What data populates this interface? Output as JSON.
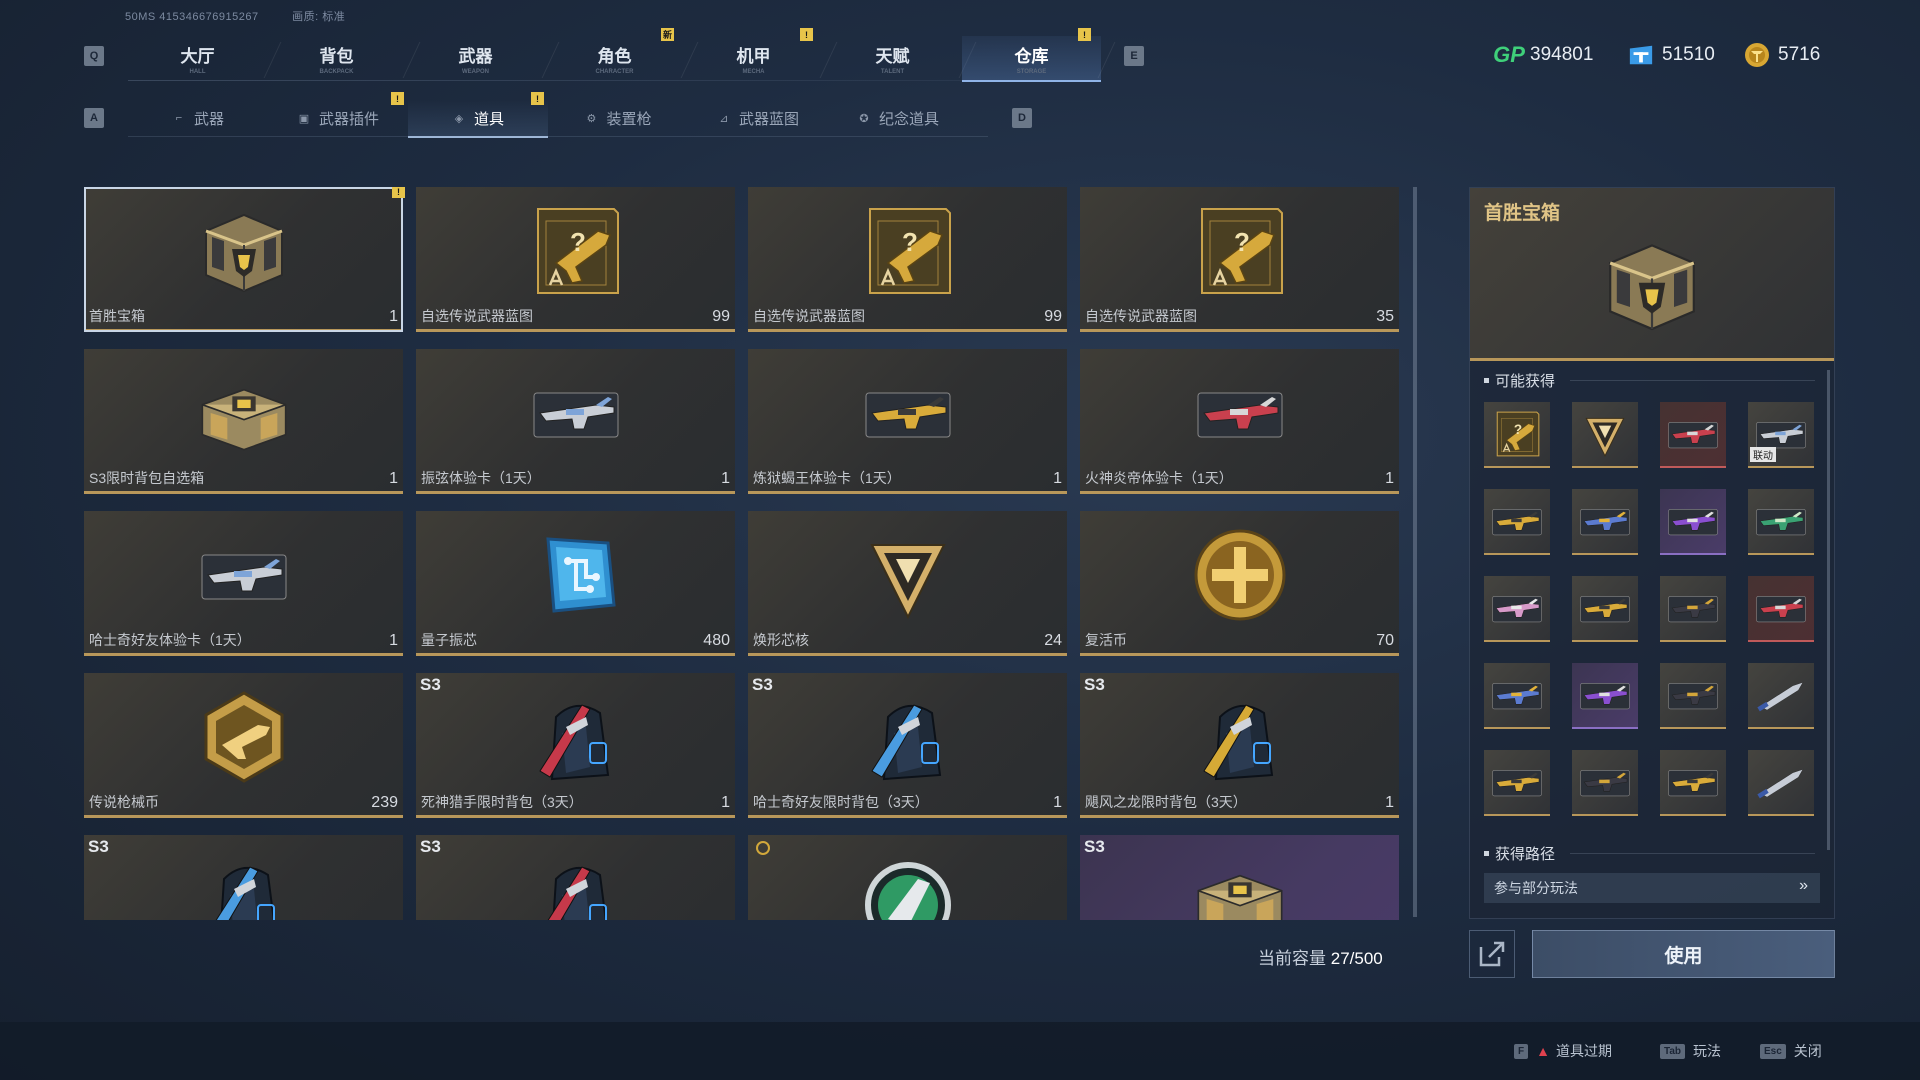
{
  "debug": {
    "line1": "50MS 415346676915267",
    "line2": "画质: 标准"
  },
  "keys": {
    "q": "Q",
    "e": "E",
    "a": "A",
    "d": "D"
  },
  "main_tabs": [
    {
      "label": "大厅",
      "sub": "HALL",
      "badge": ""
    },
    {
      "label": "背包",
      "sub": "BACKPACK",
      "badge": ""
    },
    {
      "label": "武器",
      "sub": "WEAPON",
      "badge": ""
    },
    {
      "label": "角色",
      "sub": "CHARACTER",
      "badge": "新"
    },
    {
      "label": "机甲",
      "sub": "MECHA",
      "badge": "!"
    },
    {
      "label": "天赋",
      "sub": "TALENT",
      "badge": ""
    },
    {
      "label": "仓库",
      "sub": "STORAGE",
      "badge": "!",
      "active": true
    }
  ],
  "currency": {
    "gp": {
      "icon": "GP",
      "value": "394801"
    },
    "ticket": {
      "value": "51510"
    },
    "coin": {
      "value": "5716"
    }
  },
  "sub_tabs": [
    {
      "label": "武器",
      "icon": "gun-icon"
    },
    {
      "label": "武器插件",
      "icon": "chip-icon",
      "badge": "!"
    },
    {
      "label": "道具",
      "icon": "tag-icon",
      "badge": "!",
      "active": true
    },
    {
      "label": "装置枪",
      "icon": "device-icon"
    },
    {
      "label": "武器蓝图",
      "icon": "blueprint-icon"
    },
    {
      "label": "纪念道具",
      "icon": "medal-icon"
    }
  ],
  "items": [
    {
      "name": "首胜宝箱",
      "count": "1",
      "kind": "chest",
      "badge": "!"
    },
    {
      "name": "自选传说武器蓝图",
      "count": "99",
      "kind": "blueprint"
    },
    {
      "name": "自选传说武器蓝图",
      "count": "99",
      "kind": "blueprint"
    },
    {
      "name": "自选传说武器蓝图",
      "count": "35",
      "kind": "blueprint"
    },
    {
      "name": "S3限时背包自选箱",
      "count": "1",
      "kind": "bigchest"
    },
    {
      "name": "振弦体验卡（1天）",
      "count": "1",
      "kind": "gun-silver"
    },
    {
      "name": "炼狱蝎王体验卡（1天）",
      "count": "1",
      "kind": "gun-gold"
    },
    {
      "name": "火神炎帝体验卡（1天）",
      "count": "1",
      "kind": "gun-red"
    },
    {
      "name": "哈士奇好友体验卡（1天）",
      "count": "1",
      "kind": "gun-silver"
    },
    {
      "name": "量子振芯",
      "count": "480",
      "kind": "chip"
    },
    {
      "name": "焕形芯核",
      "count": "24",
      "kind": "core"
    },
    {
      "name": "复活币",
      "count": "70",
      "kind": "coin"
    },
    {
      "name": "传说枪械币",
      "count": "239",
      "kind": "hexcoin"
    },
    {
      "name": "死神猎手限时背包（3天）",
      "count": "1",
      "kind": "backpack-red",
      "season": "S3"
    },
    {
      "name": "哈士奇好友限时背包（3天）",
      "count": "1",
      "kind": "backpack-blue",
      "season": "S3"
    },
    {
      "name": "飓风之龙限时背包（3天）",
      "count": "1",
      "kind": "backpack-gold",
      "season": "S3"
    },
    {
      "name": "",
      "count": "",
      "kind": "backpack-blue",
      "season": "S3"
    },
    {
      "name": "",
      "count": "",
      "kind": "backpack-red",
      "season": "S3"
    },
    {
      "name": "",
      "count": "",
      "kind": "emblem",
      "timer": true
    },
    {
      "name": "",
      "count": "",
      "kind": "bigchest",
      "season": "S3",
      "purple": true
    }
  ],
  "capacity": {
    "label": "当前容量",
    "value": "27/500"
  },
  "detail": {
    "title": "首胜宝箱",
    "possible_label": "可能获得",
    "source_label": "获得路径",
    "source_item": "参与部分玩法",
    "rewards": [
      {
        "kind": "blueprint"
      },
      {
        "kind": "core"
      },
      {
        "kind": "gun-red",
        "rarity": "red"
      },
      {
        "kind": "gun-silver",
        "tag": "联动"
      },
      {
        "kind": "gun-gold"
      },
      {
        "kind": "gun-blue"
      },
      {
        "kind": "gun-purple",
        "rarity": "purple"
      },
      {
        "kind": "gun-green"
      },
      {
        "kind": "gun-pink"
      },
      {
        "kind": "gun-gold"
      },
      {
        "kind": "gun-dark"
      },
      {
        "kind": "gun-red",
        "rarity": "red"
      },
      {
        "kind": "gun-blue"
      },
      {
        "kind": "gun-purple",
        "rarity": "purple"
      },
      {
        "kind": "gun-dark"
      },
      {
        "kind": "knife"
      },
      {
        "kind": "gun-gold"
      },
      {
        "kind": "gun-dark"
      },
      {
        "kind": "gun-gold"
      },
      {
        "kind": "knife"
      }
    ]
  },
  "use_button": "使用",
  "footer": [
    {
      "key": "F",
      "label": "道具过期",
      "warn": true
    },
    {
      "key": "Tab",
      "label": "玩法"
    },
    {
      "key": "Esc",
      "label": "关闭"
    }
  ]
}
